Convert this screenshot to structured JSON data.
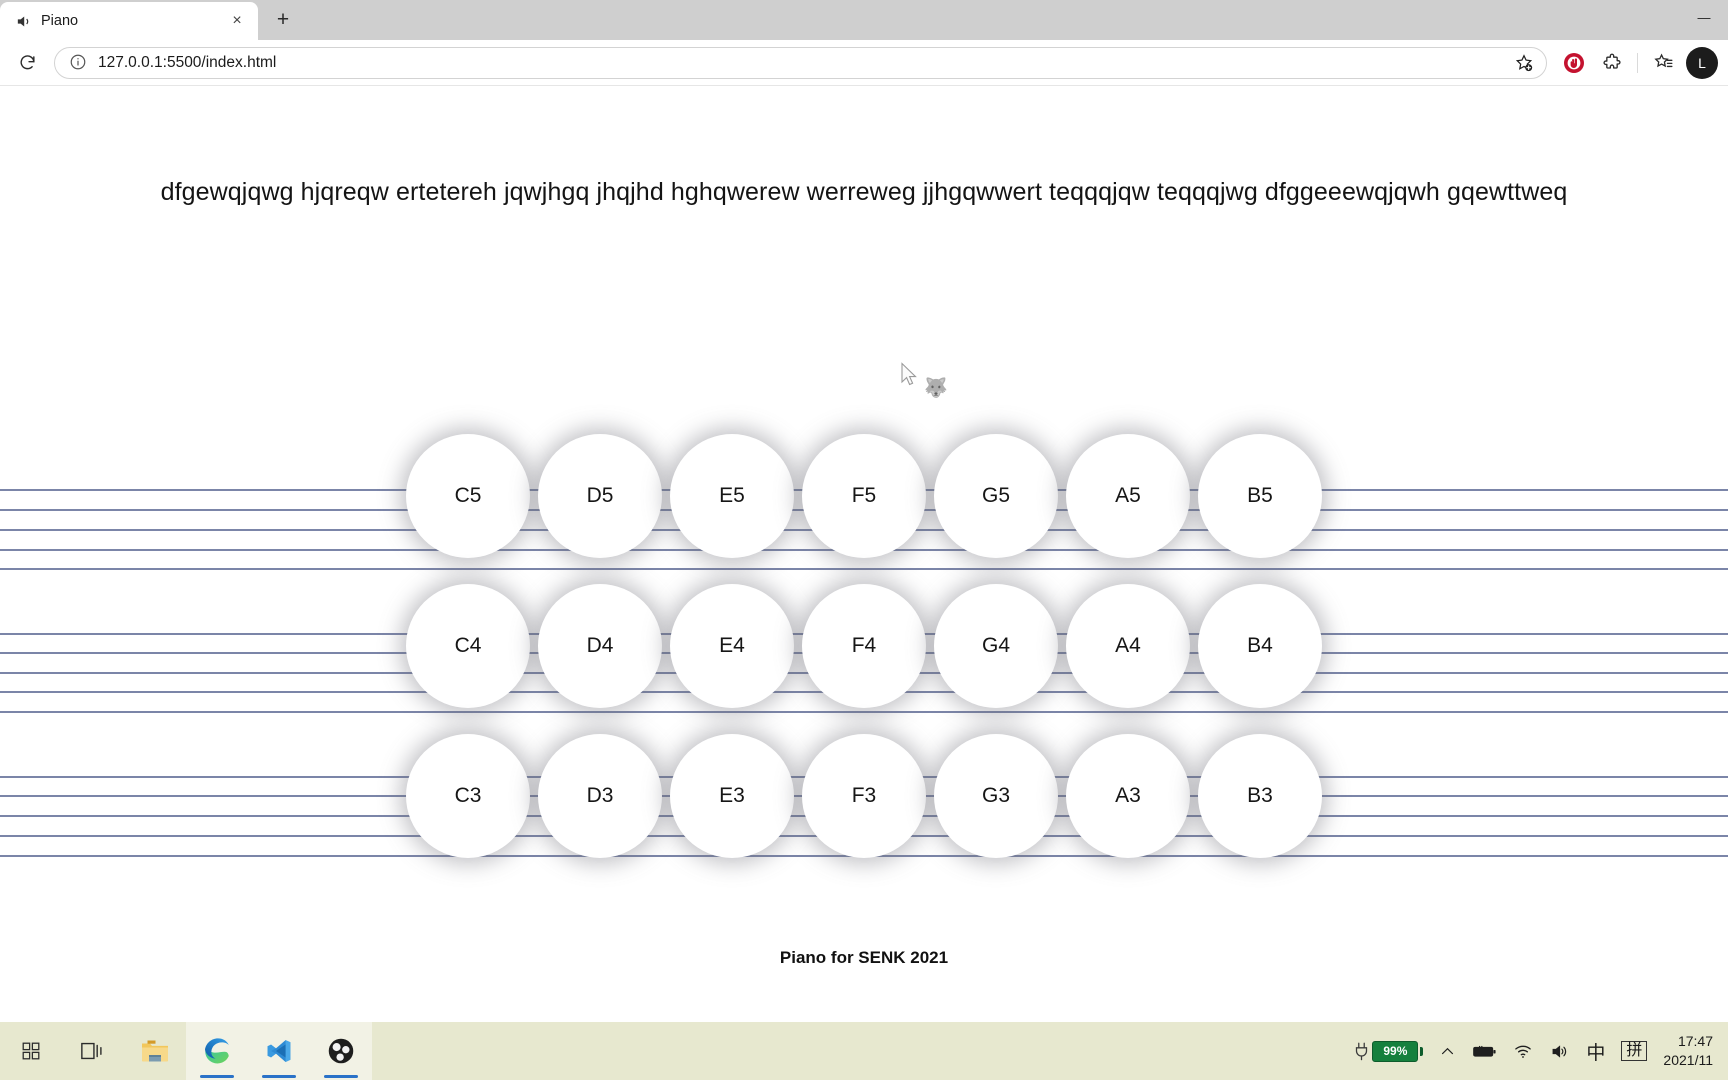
{
  "browser": {
    "tab": {
      "title": "Piano",
      "audio_icon": "speaker-playing-icon",
      "close_icon": "×"
    },
    "new_tab_label": "+",
    "window_controls": {
      "minimize": "—"
    },
    "toolbar": {
      "reload_icon": "reload-icon",
      "site_info_icon": "info-circle-icon",
      "url_host": "127.0.0.1",
      "url_port": ":5500",
      "url_path": "/index.html",
      "url_full": "127.0.0.1:5500/index.html",
      "favorite_icon": "star-add-icon",
      "adblock_icon": "adblock-extension-icon",
      "extensions_icon": "puzzle-piece-icon",
      "collections_icon": "collections-icon",
      "profile_initial": "L",
      "accent_red": "#c4122f"
    }
  },
  "page": {
    "headline": "dfgewqjqwg hjqreqw ertetereh jqwjhgq jhqjhd hghqwerew werreweg jjhgqwwert teqqqjqw teqqqjwg  dfggeeewqjqwh gqewttweq",
    "footer": "Piano for SENK 2021",
    "staff_line_color": "#7b85a8",
    "keyboard": {
      "rows": [
        {
          "octave": "5",
          "keys": [
            "C5",
            "D5",
            "E5",
            "F5",
            "G5",
            "A5",
            "B5"
          ]
        },
        {
          "octave": "4",
          "keys": [
            "C4",
            "D4",
            "E4",
            "F4",
            "G4",
            "A4",
            "B4"
          ]
        },
        {
          "octave": "3",
          "keys": [
            "C3",
            "D3",
            "E3",
            "F3",
            "G3",
            "A3",
            "B3"
          ]
        }
      ]
    },
    "cursor": {
      "pet_glyph": "🐺"
    }
  },
  "taskbar": {
    "items": [
      {
        "name": "start-button",
        "icon": "windows-start-icon",
        "label": ""
      },
      {
        "name": "task-view-button",
        "icon": "task-view-icon",
        "label": ""
      },
      {
        "name": "file-explorer-button",
        "icon": "folder-icon",
        "label": ""
      },
      {
        "name": "edge-button",
        "icon": "edge-browser-icon",
        "label": ""
      },
      {
        "name": "vscode-button",
        "icon": "vscode-icon",
        "label": ""
      },
      {
        "name": "obs-button",
        "icon": "obs-studio-icon",
        "label": ""
      }
    ],
    "tray": {
      "battery_percent": "99%",
      "overflow_icon": "chevron-up-icon",
      "battery_icon": "battery-charging-icon",
      "wifi_icon": "wifi-icon",
      "volume_icon": "speaker-icon",
      "ime_mode": "中",
      "ime_pinyin": "拼",
      "time": "17:47",
      "date": "2021/11"
    },
    "background": "#e7e8cf"
  }
}
